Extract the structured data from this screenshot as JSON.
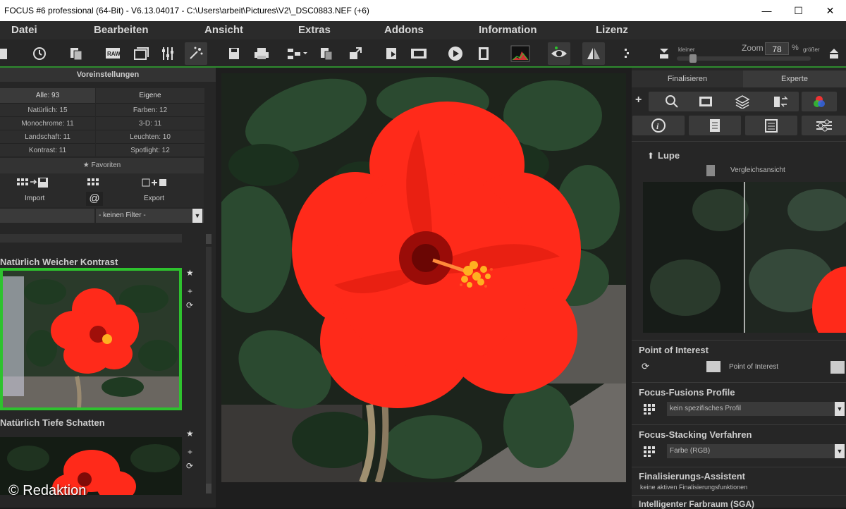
{
  "window": {
    "title": "FOCUS #6 professional (64-Bit)  - V6.13.04017 - C:\\Users\\arbeit\\Pictures\\V2\\_DSC0883.NEF (+6)",
    "minimize": "—",
    "maximize": "☐",
    "close": "✕"
  },
  "menu": [
    "Datei",
    "Bearbeiten",
    "Ansicht",
    "Extras",
    "Addons",
    "Information",
    "Lizenz"
  ],
  "zoom": {
    "kleiner": "kleiner",
    "label": "Zoom",
    "value": "78",
    "unit": "%",
    "groesser": "größer"
  },
  "presets": {
    "header": "Voreinstellungen",
    "all": "Alle: 93",
    "own": "Eigene",
    "categories": [
      [
        "Natürlich: 15",
        "Farben: 12"
      ],
      [
        "Monochrome: 11",
        "3-D: 11"
      ],
      [
        "Landschaft: 11",
        "Leuchten: 10"
      ],
      [
        "Kontrast: 11",
        "Spotlight: 12"
      ]
    ],
    "favorites": "Favoriten",
    "import": "Import",
    "export": "Export",
    "filter": "- keinen Filter -",
    "preset1": "Natürlich Weicher Kontrast",
    "preset2": "Natürlich Tiefe Schatten"
  },
  "watermark": "© Redaktion",
  "right": {
    "tab_finalize": "Finalisieren",
    "tab_expert": "Experte",
    "lupe": "Lupe",
    "compare": "Vergleichsansicht",
    "poi_title": "Point of Interest",
    "poi_label": "Point of Interest",
    "fusion_title": "Focus-Fusions Profile",
    "fusion_value": "kein spezifisches Profil",
    "stack_title": "Focus-Stacking Verfahren",
    "stack_value": "Farbe (RGB)",
    "assist_title": "Finalisierungs-Assistent",
    "assist_value": "keine aktiven Finalisierungsfunktionen",
    "sga_title": "Intelligenter Farbraum (SGA)"
  },
  "colors": {
    "accent_green": "#2ec22e",
    "flower_red": "#ff2a1a"
  }
}
